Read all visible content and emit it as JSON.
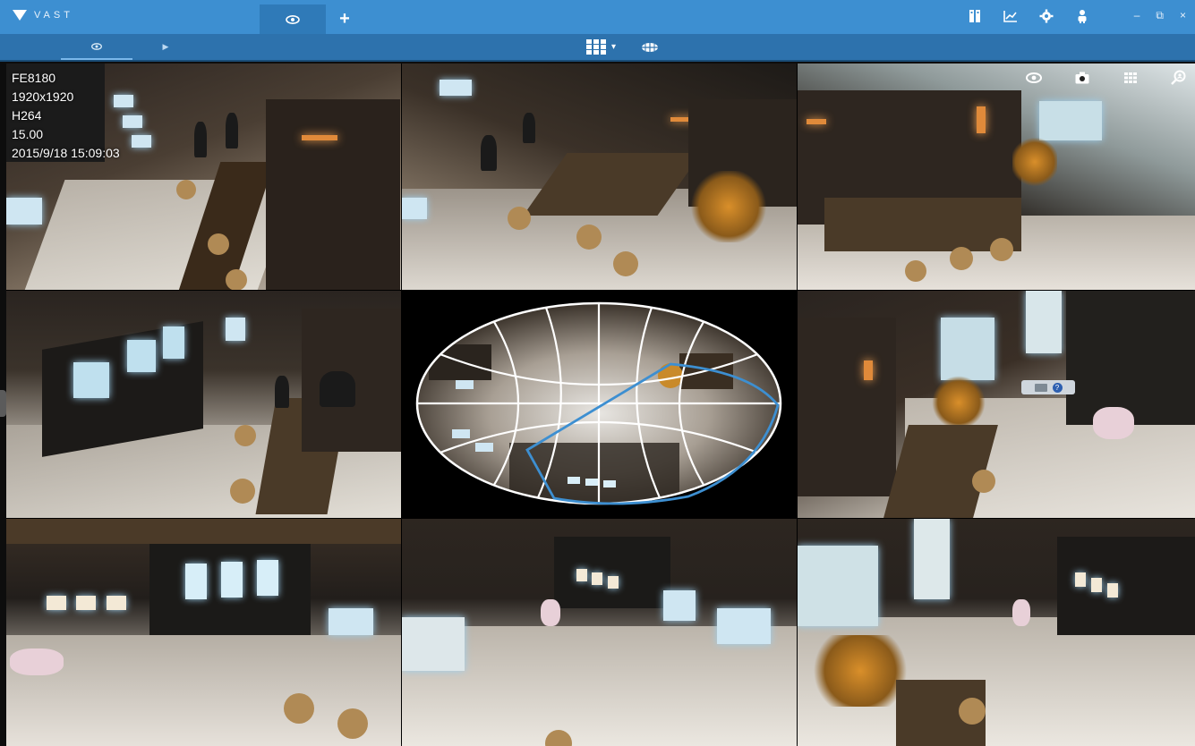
{
  "app": {
    "logo_text": "VAST",
    "colors": {
      "titlebar": "#3d8fd1",
      "toolbar": "#2d72ad",
      "accent": "#3d8fd1"
    }
  },
  "titlebar": {
    "tabs": [
      {
        "icon": "eye-icon",
        "active": true
      },
      {
        "icon": "plus-icon",
        "label": "+"
      }
    ],
    "right_icons": [
      "book-icon",
      "chart-icon",
      "gear-icon",
      "user-icon"
    ],
    "window_controls": {
      "minimize": "–",
      "restore": "⧉",
      "close": "×"
    }
  },
  "toolbar": {
    "sub_tabs": [
      {
        "icon": "eye-icon",
        "active": true
      },
      {
        "icon": "play-icon",
        "label": "▶"
      }
    ],
    "layout_icon": "grid-layout-icon",
    "layout_caret": "▾",
    "fisheye_icon": "fisheye-dewarp-icon"
  },
  "cameras": [
    {
      "overlay": [
        "FE8180",
        "1920x1920",
        "H264",
        "15.00",
        "2015/9/18 15:09:03"
      ]
    }
  ],
  "camera_tools": [
    "eye-icon",
    "snapshot-icon",
    "layout-icon",
    "search-icon"
  ],
  "ptz": {
    "help": "?"
  }
}
